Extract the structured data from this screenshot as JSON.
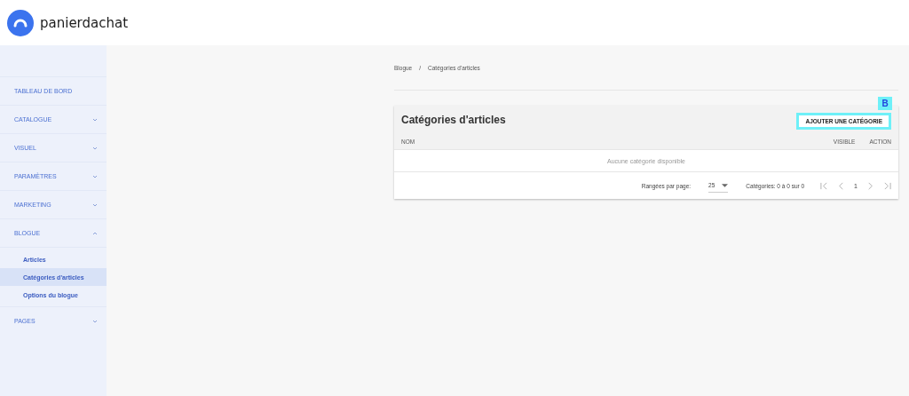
{
  "header": {
    "logo_text": "panierdachat"
  },
  "sidebar": {
    "items": [
      {
        "label": "TABLEAU DE BORD"
      },
      {
        "label": "CATALOGUE",
        "expanded": false
      },
      {
        "label": "VISUEL",
        "expanded": false
      },
      {
        "label": "PARAMÈTRES",
        "expanded": false
      },
      {
        "label": "MARKETING",
        "expanded": false
      },
      {
        "label": "BLOGUE",
        "expanded": true,
        "children": [
          {
            "label": "Articles",
            "selected": false
          },
          {
            "label": "Catégories d'articles",
            "selected": true
          },
          {
            "label": "Options du blogue",
            "selected": false
          }
        ]
      },
      {
        "label": "PAGES",
        "expanded": false
      }
    ]
  },
  "breadcrumb": [
    "Blogue",
    "/",
    "Catégories d'articles"
  ],
  "card": {
    "title": "Catégories d'articles",
    "add_button": "AJOUTER UNE CATÉGORIE",
    "marker": "B",
    "columns": [
      "NOM",
      "VISIBLE",
      "ACTION"
    ],
    "empty_message": "Aucune catégorie disponible",
    "footer": {
      "rows_label": "Rangées par page:",
      "rows_value": "25",
      "range": "Catégories: 0 à 0 sur 0",
      "page": "1"
    }
  }
}
